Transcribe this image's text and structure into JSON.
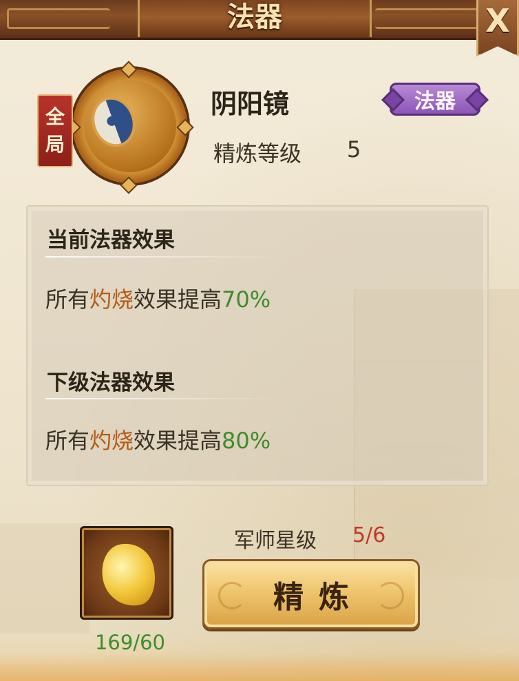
{
  "header": {
    "title": "法器",
    "close_label": "X"
  },
  "item": {
    "scope_tag": [
      "全",
      "局"
    ],
    "name": "阴阳镜",
    "type_badge": "法器",
    "refine_level_label": "精炼等级",
    "refine_level_value": "5"
  },
  "effects": {
    "current": {
      "title": "当前法器效果",
      "prefix": "所有",
      "keyword": "灼烧",
      "middle": "效果提高",
      "value": "70%"
    },
    "next": {
      "title": "下级法器效果",
      "prefix": "所有",
      "keyword": "灼烧",
      "middle": "效果提高",
      "value": "80%"
    }
  },
  "material": {
    "icon": "gold-stone-icon",
    "count": "169/60"
  },
  "star": {
    "label": "军师星级",
    "value": "5/6"
  },
  "refine_button": {
    "label": "精炼"
  },
  "colors": {
    "keyword": "#b35a18",
    "positive_value": "#3e8c2c",
    "star_value": "#c0392b",
    "badge": "#8c56b6"
  }
}
